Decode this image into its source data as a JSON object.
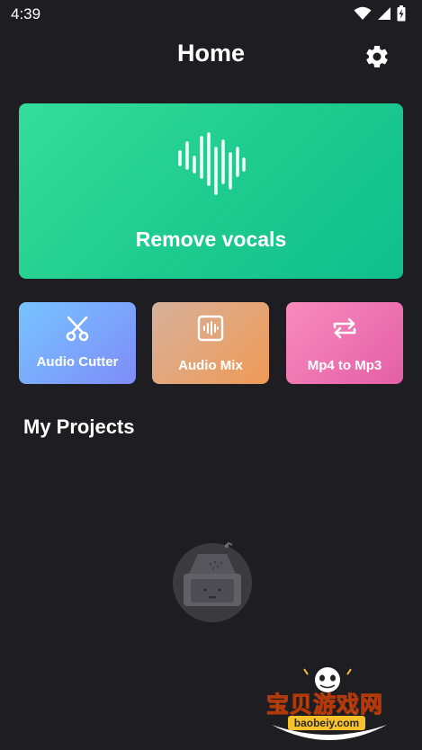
{
  "status_bar": {
    "time": "4:39",
    "icons": [
      "wifi-icon",
      "signal-icon",
      "battery-icon"
    ]
  },
  "header": {
    "title": "Home",
    "settings_icon": "gear-icon"
  },
  "hero": {
    "label": "Remove vocals",
    "icon": "sound-wave-icon",
    "colors": [
      "#34dd9a",
      "#0fbf8c"
    ]
  },
  "tools": [
    {
      "label": "Audio Cutter",
      "icon": "scissors-icon",
      "colors": [
        "#77c4ff",
        "#7f8cf8"
      ]
    },
    {
      "label": "Audio Mix",
      "icon": "waveform-box-icon",
      "colors": [
        "#d7b19b",
        "#ef9a55"
      ]
    },
    {
      "label": "Mp4 to Mp3",
      "icon": "repeat-arrows-icon",
      "colors": [
        "#f88bbd",
        "#e45fa6"
      ]
    }
  ],
  "projects": {
    "title": "My Projects",
    "empty_icon": "empty-inbox-icon"
  },
  "watermark": {
    "text": "宝贝游戏网",
    "url": "baobeiy.com"
  }
}
